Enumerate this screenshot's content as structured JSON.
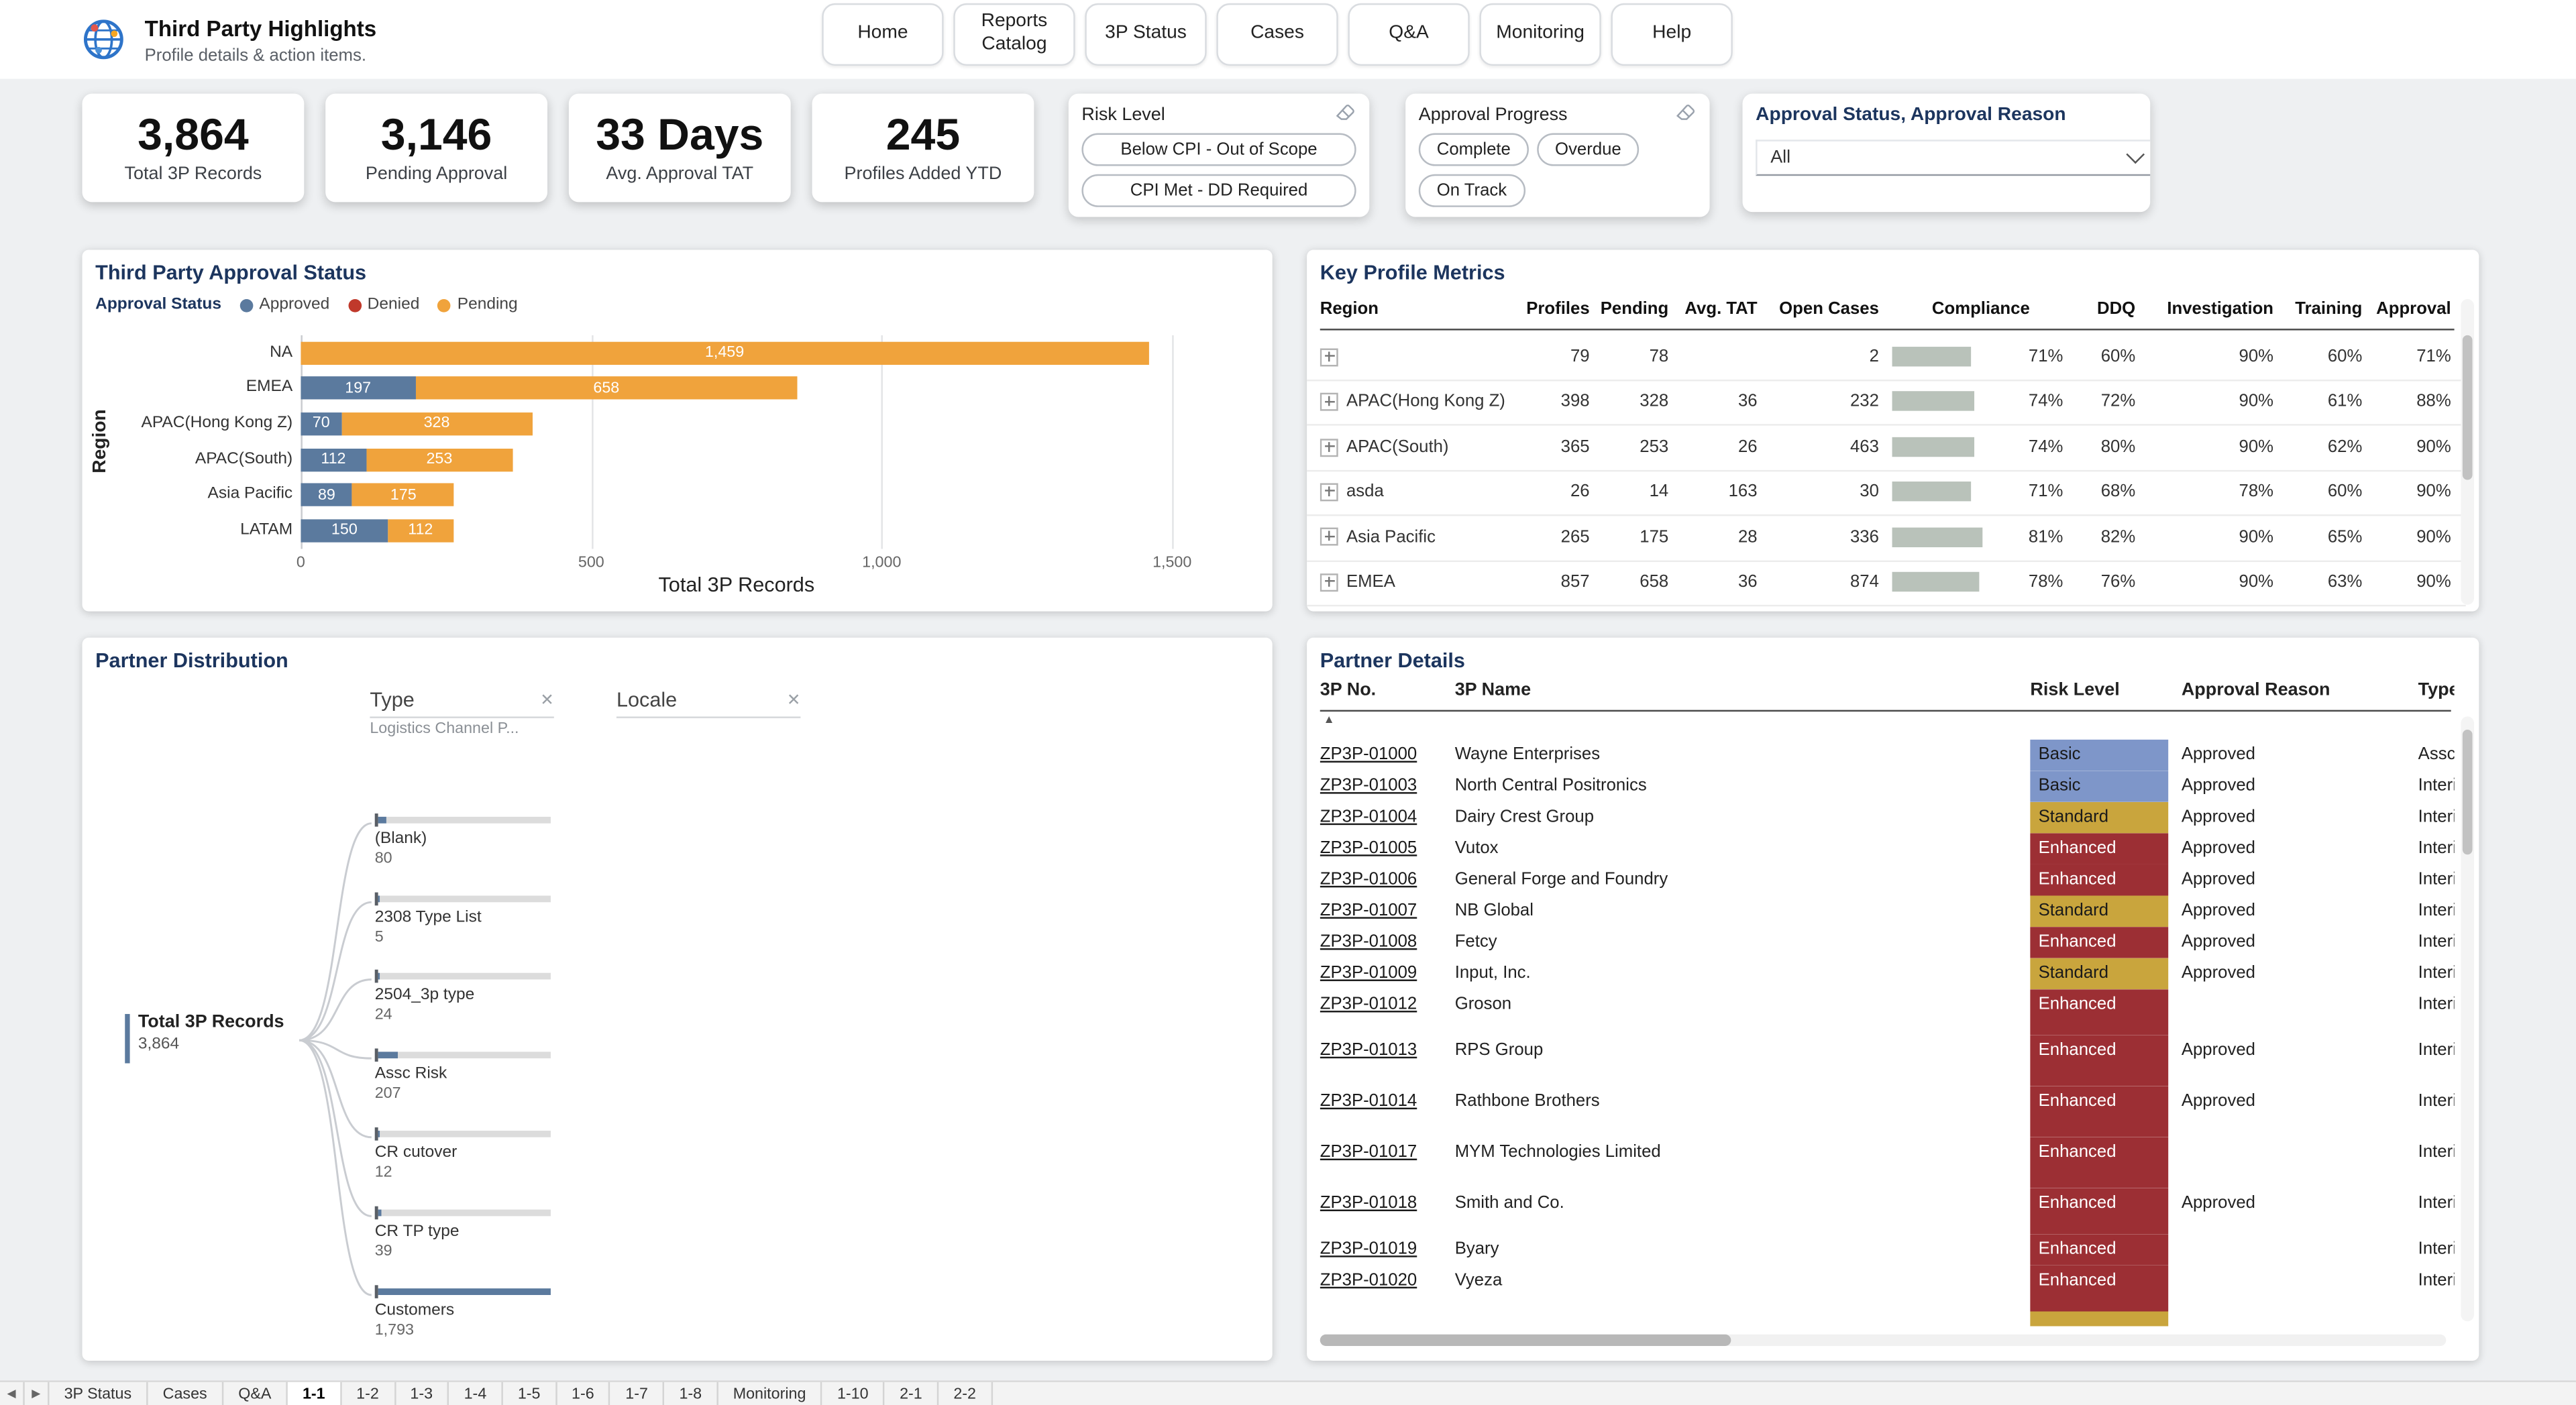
{
  "colors": {
    "navy": "#1c355e",
    "approved": "#5b7a9e",
    "denied": "#c0392b",
    "pending": "#f0a33c",
    "compliance_bar": "#b9c2ba",
    "tree_bar": "#5b7a9e",
    "risk_basic": "#7e96c9",
    "risk_standard": "#c9a53d",
    "risk_enhanced": "#9c2f34"
  },
  "icons": {
    "logo": "globe-icon",
    "clear_filter": "eraser-icon",
    "dropdown": "chevron-down-icon",
    "sort_ascending": "▲",
    "close": "✕",
    "tab_prev": "◀",
    "tab_next": "▶"
  },
  "header": {
    "title": "Third Party Highlights",
    "subtitle": "Profile details & action items.",
    "nav": [
      "Home",
      "Reports Catalog",
      "3P Status",
      "Cases",
      "Q&A",
      "Monitoring",
      "Help"
    ]
  },
  "kpis": [
    {
      "value": "3,864",
      "label": "Total 3P Records"
    },
    {
      "value": "3,146",
      "label": "Pending Approval"
    },
    {
      "value": "33 Days",
      "label": "Avg. Approval TAT"
    },
    {
      "value": "245",
      "label": "Profiles Added YTD"
    }
  ],
  "filters": {
    "risk_level": {
      "title": "Risk Level",
      "options": [
        "Below CPI - Out of Scope",
        "CPI Met - DD Required"
      ]
    },
    "approval_progress": {
      "title": "Approval Progress",
      "options": [
        "Complete",
        "Overdue",
        "On Track"
      ]
    },
    "approval_status": {
      "title": "Approval Status, Approval Reason",
      "value": "All"
    }
  },
  "chart_data": {
    "type": "bar",
    "orientation": "horizontal-stacked",
    "title": "Third Party Approval Status",
    "legend_label": "Approval Status",
    "legend": [
      "Approved",
      "Denied",
      "Pending"
    ],
    "categories": [
      "NA",
      "EMEA",
      "APAC(Hong Kong Z)",
      "APAC(South)",
      "Asia Pacific",
      "LATAM"
    ],
    "series": [
      {
        "name": "Approved",
        "values": [
          0,
          197,
          70,
          112,
          89,
          150
        ]
      },
      {
        "name": "Denied",
        "values": [
          0,
          0,
          0,
          0,
          0,
          0
        ]
      },
      {
        "name": "Pending",
        "values": [
          1459,
          658,
          328,
          253,
          175,
          112
        ]
      }
    ],
    "xlabel": "Total 3P Records",
    "ylabel": "Region",
    "x_ticks": [
      "0",
      "500",
      "1,000",
      "1,500"
    ],
    "xlim": [
      0,
      1500
    ],
    "grid": true,
    "legend_position": "top"
  },
  "metrics": {
    "title": "Key Profile Metrics",
    "columns": [
      "Region",
      "Profiles",
      "Pending",
      "Avg. TAT",
      "Open Cases",
      "Compliance",
      "DDQ",
      "Investigation",
      "Training",
      "Approval"
    ],
    "rows": [
      {
        "region": "",
        "profiles": "79",
        "pending": "78",
        "avg_tat": "",
        "open_cases": "2",
        "compliance": 71,
        "ddq": "60%",
        "investigation": "90%",
        "training": "60%",
        "approval": "71%"
      },
      {
        "region": "APAC(Hong Kong Z)",
        "profiles": "398",
        "pending": "328",
        "avg_tat": "36",
        "open_cases": "232",
        "compliance": 74,
        "ddq": "72%",
        "investigation": "90%",
        "training": "61%",
        "approval": "88%"
      },
      {
        "region": "APAC(South)",
        "profiles": "365",
        "pending": "253",
        "avg_tat": "26",
        "open_cases": "463",
        "compliance": 74,
        "ddq": "80%",
        "investigation": "90%",
        "training": "62%",
        "approval": "90%"
      },
      {
        "region": "asda",
        "profiles": "26",
        "pending": "14",
        "avg_tat": "163",
        "open_cases": "30",
        "compliance": 71,
        "ddq": "68%",
        "investigation": "78%",
        "training": "60%",
        "approval": "90%"
      },
      {
        "region": "Asia Pacific",
        "profiles": "265",
        "pending": "175",
        "avg_tat": "28",
        "open_cases": "336",
        "compliance": 81,
        "ddq": "82%",
        "investigation": "90%",
        "training": "65%",
        "approval": "90%"
      },
      {
        "region": "EMEA",
        "profiles": "857",
        "pending": "658",
        "avg_tat": "36",
        "open_cases": "874",
        "compliance": 78,
        "ddq": "76%",
        "investigation": "90%",
        "training": "63%",
        "approval": "90%"
      }
    ]
  },
  "distribution": {
    "title": "Partner Distribution",
    "slicers": [
      {
        "label": "Type",
        "sub": "Logistics Channel P..."
      },
      {
        "label": "Locale",
        "sub": ""
      }
    ],
    "root": {
      "label": "Total 3P Records",
      "value": "3,864"
    },
    "max_node_value": 1793,
    "nodes": [
      {
        "label": "(Blank)",
        "value": "80",
        "num": 80
      },
      {
        "label": "2308 Type List",
        "value": "5",
        "num": 5
      },
      {
        "label": "2504_3p type",
        "value": "24",
        "num": 24
      },
      {
        "label": "Assc Risk",
        "value": "207",
        "num": 207
      },
      {
        "label": "CR cutover",
        "value": "12",
        "num": 12
      },
      {
        "label": "CR TP type",
        "value": "39",
        "num": 39
      },
      {
        "label": "Customers",
        "value": "1,793",
        "num": 1793
      }
    ]
  },
  "details": {
    "title": "Partner Details",
    "columns": [
      "3P No.",
      "3P Name",
      "Risk Level",
      "Approval Reason",
      "Type"
    ],
    "rows": [
      {
        "no": "ZP3P-01000",
        "name": "Wayne Enterprises",
        "risk": "Basic",
        "reason": "Approved",
        "type": "Assc"
      },
      {
        "no": "ZP3P-01003",
        "name": "North Central Positronics",
        "risk": "Basic",
        "reason": "Approved",
        "type": "Interi"
      },
      {
        "no": "ZP3P-01004",
        "name": "Dairy Crest Group",
        "risk": "Standard",
        "reason": "Approved",
        "type": "Interi"
      },
      {
        "no": "ZP3P-01005",
        "name": "Vutox",
        "risk": "Enhanced",
        "reason": "Approved",
        "type": "Interi"
      },
      {
        "no": "ZP3P-01006",
        "name": "General Forge and Foundry",
        "risk": "Enhanced",
        "reason": "Approved",
        "type": "Interi"
      },
      {
        "no": "ZP3P-01007",
        "name": "NB Global",
        "risk": "Standard",
        "reason": "Approved",
        "type": "Interi"
      },
      {
        "no": "ZP3P-01008",
        "name": "Fetcy",
        "risk": "Enhanced",
        "reason": "Approved",
        "type": "Interi"
      },
      {
        "no": "ZP3P-01009",
        "name": "Input, Inc.",
        "risk": "Standard",
        "reason": "Approved",
        "type": "Interi"
      },
      {
        "no": "ZP3P-01012",
        "name": "Groson",
        "risk": "Enhanced",
        "reason": "",
        "type": "Interi"
      },
      {
        "no": "ZP3P-01013",
        "name": "RPS Group",
        "risk": "Enhanced",
        "reason": "Approved",
        "type": "Interi"
      },
      {
        "no": "ZP3P-01014",
        "name": "Rathbone Brothers",
        "risk": "Enhanced",
        "reason": "Approved",
        "type": "Interi"
      },
      {
        "no": "ZP3P-01017",
        "name": "MYM Technologies Limited",
        "risk": "Enhanced",
        "reason": "",
        "type": "Interi"
      },
      {
        "no": "ZP3P-01018",
        "name": "Smith and Co.",
        "risk": "Enhanced",
        "reason": "Approved",
        "type": "Interi"
      },
      {
        "no": "ZP3P-01019",
        "name": "Byary",
        "risk": "Enhanced",
        "reason": "",
        "type": "Interi"
      },
      {
        "no": "ZP3P-01020",
        "name": "Vyeza",
        "risk": "Enhanced",
        "reason": "",
        "type": "Interi"
      }
    ],
    "partial_row_risk": "Standard"
  },
  "sheet_tabs": {
    "active": "1-1",
    "tabs": [
      "3P Status",
      "Cases",
      "Q&A",
      "1-1",
      "1-2",
      "1-3",
      "1-4",
      "1-5",
      "1-6",
      "1-7",
      "1-8",
      "Monitoring",
      "1-10",
      "2-1",
      "2-2"
    ]
  }
}
